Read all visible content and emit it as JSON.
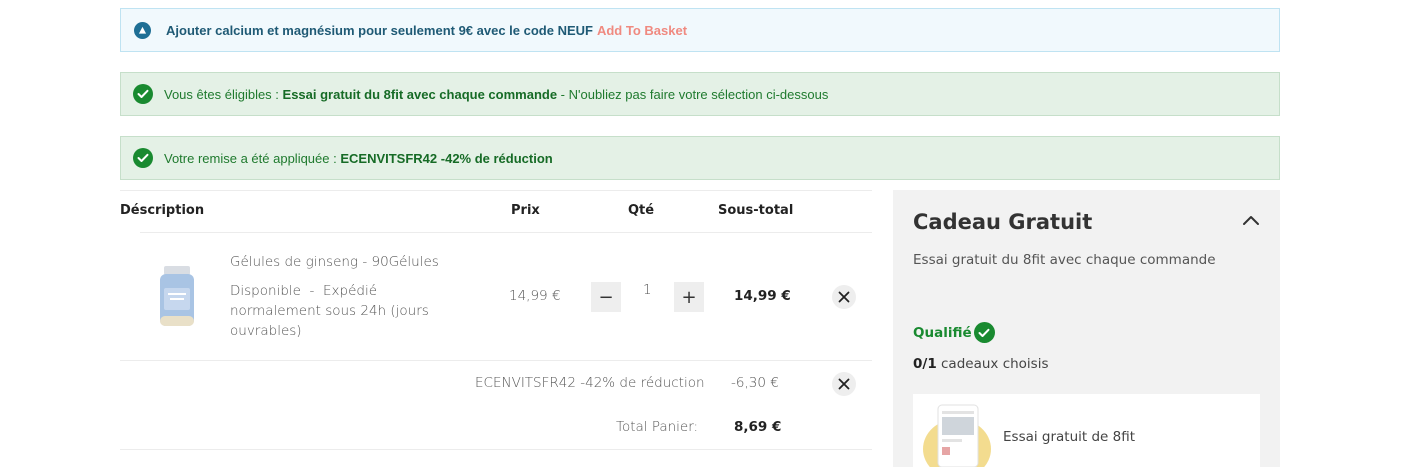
{
  "banners": {
    "promo": {
      "text": "Ajouter calcium et magnésium pour seulement 9€ avec le code NEUF",
      "link": "Add To Basket"
    },
    "eligible": {
      "prefix": "Vous êtes éligibles : ",
      "bold": "Essai gratuit du 8fit avec chaque commande",
      "suffix": " - N'oubliez pas faire votre sélection ci-dessous"
    },
    "discount": {
      "prefix": "Votre remise a été appliquée : ",
      "bold": "ECENVITSFR42 -42% de réduction"
    }
  },
  "table": {
    "headers": {
      "description": "Déscription",
      "price": "Prix",
      "qty": "Qté",
      "subtotal": "Sous-total"
    },
    "item": {
      "name": "Gélules de ginseng - 90Gélules",
      "availability_line1": "Disponible  -  Expédié",
      "availability_line2": "normalement sous 24h (jours",
      "availability_line3": "ouvrables)",
      "price": "14,99 €",
      "qty": "1",
      "minus": "−",
      "plus": "+",
      "subtotal": "14,99 €"
    },
    "discount_row": {
      "label": "ECENVITSFR42 -42% de réduction",
      "value": "-6,30 €"
    },
    "total": {
      "label": "Total Panier:",
      "value": "8,69 €"
    }
  },
  "sidebar": {
    "title": "Cadeau Gratuit",
    "description": "Essai gratuit du 8fit avec chaque commande",
    "qualified": "Qualifié",
    "count_bold": "0/1",
    "count_text": " cadeaux choisis",
    "gift_label": "Essai gratuit de 8fit"
  },
  "colors": {
    "success": "#198a30",
    "info": "#1f6f95",
    "link": "#f08a80"
  }
}
